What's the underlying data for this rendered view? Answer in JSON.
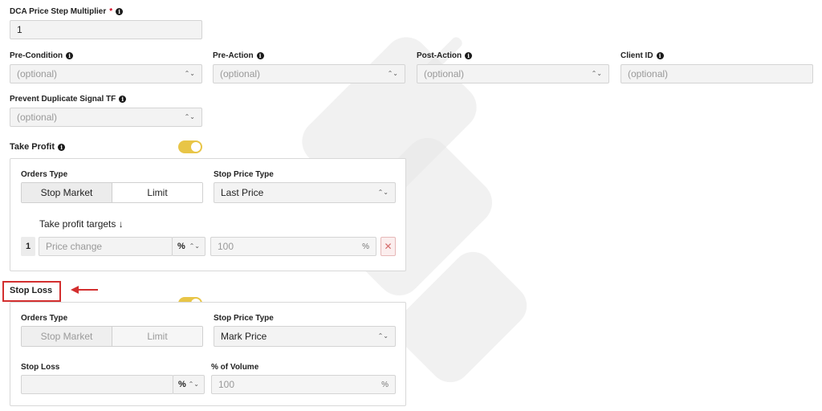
{
  "dca_price_step_multiplier": {
    "label": "DCA Price Step Multiplier",
    "required_mark": "*",
    "value": "1"
  },
  "pre_condition": {
    "label": "Pre-Condition",
    "placeholder": "(optional)"
  },
  "pre_action": {
    "label": "Pre-Action",
    "placeholder": "(optional)"
  },
  "post_action": {
    "label": "Post-Action",
    "placeholder": "(optional)"
  },
  "client_id": {
    "label": "Client ID",
    "placeholder": "(optional)"
  },
  "prevent_duplicate": {
    "label": "Prevent Duplicate Signal TF",
    "placeholder": "(optional)"
  },
  "take_profit": {
    "title": "Take Profit",
    "enabled": true,
    "orders_type_label": "Orders Type",
    "orders_type_options": [
      "Stop Market",
      "Limit"
    ],
    "orders_type_selected": "Stop Market",
    "stop_price_type_label": "Stop Price Type",
    "stop_price_type_value": "Last Price",
    "targets_label": "Take profit targets ↓",
    "target_index": "1",
    "price_change_placeholder": "Price change",
    "unit": "%",
    "volume_placeholder": "100",
    "volume_unit": "%"
  },
  "stop_loss": {
    "title": "Stop Loss",
    "enabled": true,
    "orders_type_label": "Orders Type",
    "orders_type_options": [
      "Stop Market",
      "Limit"
    ],
    "orders_type_selected": "Stop Market",
    "stop_price_type_label": "Stop Price Type",
    "stop_price_type_value": "Mark Price",
    "stop_loss_label": "Stop Loss",
    "stop_loss_value": "",
    "unit": "%",
    "volume_label": "% of Volume",
    "volume_placeholder": "100",
    "volume_unit": "%"
  },
  "colors": {
    "toggle": "#e8c547",
    "highlight": "#d32f2f",
    "required": "#d0021b"
  }
}
